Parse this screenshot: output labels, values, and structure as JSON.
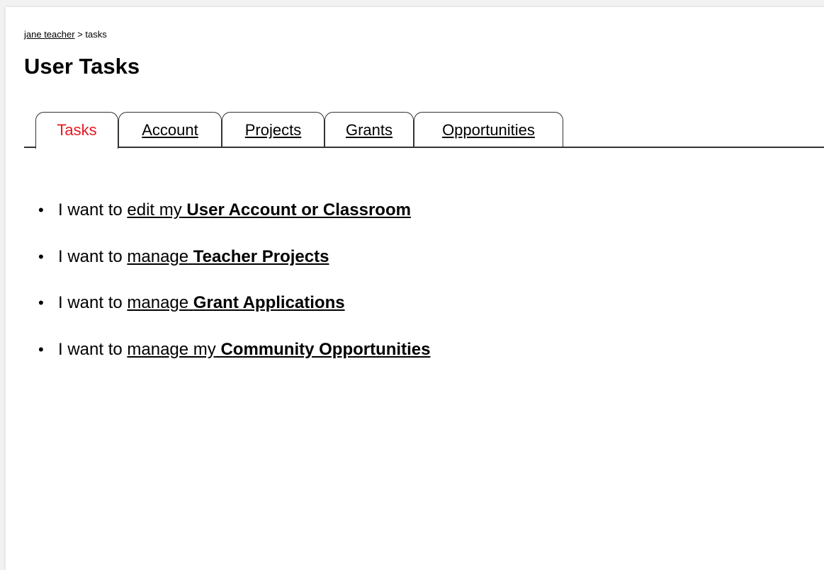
{
  "breadcrumb": {
    "user_link": "jane teacher",
    "separator": ">",
    "current": "tasks"
  },
  "page_title": "User Tasks",
  "tabs": [
    {
      "label": "Tasks",
      "active": true
    },
    {
      "label": "Account",
      "active": false
    },
    {
      "label": "Projects",
      "active": false
    },
    {
      "label": "Grants",
      "active": false
    },
    {
      "label": "Opportunities",
      "active": false
    }
  ],
  "tasks": [
    {
      "prefix": "I want to",
      "link_verb": "edit my",
      "link_object": "User Account or Classroom"
    },
    {
      "prefix": "I want to",
      "link_verb": "manage",
      "link_object": "Teacher Projects"
    },
    {
      "prefix": "I want to",
      "link_verb": "manage",
      "link_object": "Grant Applications"
    },
    {
      "prefix": "I want to",
      "link_verb": "manage my",
      "link_object": "Community Opportunities"
    }
  ],
  "colors": {
    "active_tab_text": "#e8171f",
    "link_text": "#000000",
    "background": "#ffffff"
  },
  "icons": {
    "list_bullet": "bullet-icon"
  }
}
